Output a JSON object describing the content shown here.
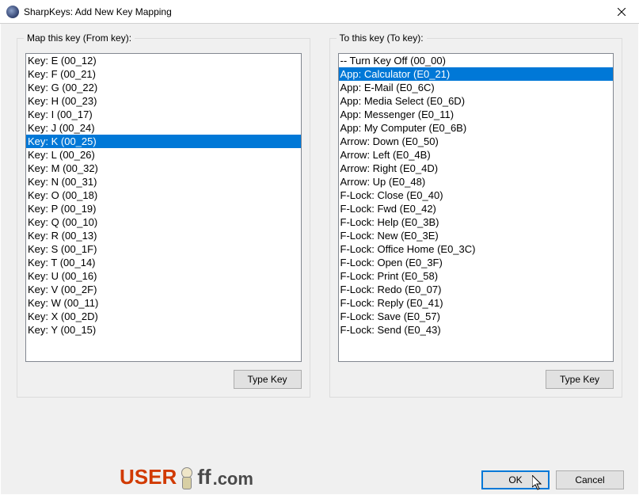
{
  "window": {
    "title": "SharpKeys: Add New Key Mapping",
    "close_label": "Close"
  },
  "from_panel": {
    "label": "Map this key (From key):",
    "type_key_label": "Type Key",
    "selected_index": 6,
    "items": [
      "Key: E (00_12)",
      "Key: F (00_21)",
      "Key: G (00_22)",
      "Key: H (00_23)",
      "Key: I (00_17)",
      "Key: J (00_24)",
      "Key: K (00_25)",
      "Key: L (00_26)",
      "Key: M (00_32)",
      "Key: N (00_31)",
      "Key: O (00_18)",
      "Key: P (00_19)",
      "Key: Q (00_10)",
      "Key: R (00_13)",
      "Key: S (00_1F)",
      "Key: T (00_14)",
      "Key: U (00_16)",
      "Key: V (00_2F)",
      "Key: W (00_11)",
      "Key: X (00_2D)",
      "Key: Y (00_15)"
    ]
  },
  "to_panel": {
    "label": "To this key (To key):",
    "type_key_label": "Type Key",
    "selected_index": 1,
    "items": [
      "-- Turn Key Off (00_00)",
      "App: Calculator (E0_21)",
      "App: E-Mail (E0_6C)",
      "App: Media Select (E0_6D)",
      "App: Messenger (E0_11)",
      "App: My Computer (E0_6B)",
      "Arrow: Down (E0_50)",
      "Arrow: Left (E0_4B)",
      "Arrow: Right (E0_4D)",
      "Arrow: Up (E0_48)",
      "F-Lock: Close (E0_40)",
      "F-Lock: Fwd (E0_42)",
      "F-Lock: Help (E0_3B)",
      "F-Lock: New (E0_3E)",
      "F-Lock: Office Home (E0_3C)",
      "F-Lock: Open (E0_3F)",
      "F-Lock: Print (E0_58)",
      "F-Lock: Redo (E0_07)",
      "F-Lock: Reply (E0_41)",
      "F-Lock: Save (E0_57)",
      "F-Lock: Send (E0_43)"
    ]
  },
  "buttons": {
    "ok": "OK",
    "cancel": "Cancel"
  },
  "watermark": {
    "part1": "USER",
    "part2": "ff",
    "part3": ".com"
  }
}
